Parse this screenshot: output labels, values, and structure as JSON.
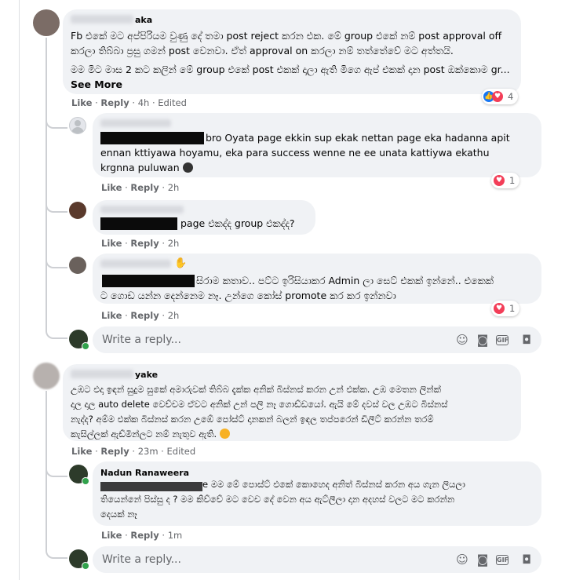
{
  "comments": [
    {
      "name_suffix": "aka",
      "para1": "Fb එකේ මට අප්පිරියම වුණු දේ තමා post reject කරන එක. මේ group එකේ නම් post approval off කරලා තිබ්බා ප්‍රසු ගමන් post වෙනවා. ඒත් approval on කරලා නම් තත්තේවේ මට අත්තයි.",
      "para2": "මම මිට මාස 2 කට කලින් මේ group එකේ post එකක් දාලා ඇති මිගෙ ඇප් එකක් දාන post ඔක්කොම gr...",
      "see_more": "See More",
      "like": "Like",
      "reply": "Reply",
      "time": "4h",
      "edited": "Edited",
      "reaction_count": "4"
    },
    {
      "text_line1": "bro Oyata page ekkin sup ekak nettan page eka hadanna apit",
      "text_line2": "ennan kttiyawa hoyamu, eka para success wenne ne ee unata kattiywa ekathu",
      "text_line3": "krgnna puluwan",
      "like": "Like",
      "reply": "Reply",
      "time": "2h",
      "reaction_count": "1"
    },
    {
      "text": "page එකද්ද group එකද්ද?",
      "like": "Like",
      "reply": "Reply",
      "time": "2h"
    },
    {
      "text_line1": "සිරාම කතාව.. පට්ට ඉරිසියාකර Admin ලා සෙට් එකක් ඉන්නේ.. එකෙක්",
      "text_line2": "ට ගොඩ යන්න දෙන්නෙම නෑ. උන්ගෙ කෝස් promote කර කර ඉන්නවා",
      "like": "Like",
      "reply": "Reply",
      "time": "2h",
      "reaction_count": "1"
    },
    {
      "name_suffix": "yake",
      "text_line1": "උඹට එදා ඉඳන් සුදුම සුකේ අමාරුවක් තිබ්බ දැක්ක අනික් බිස්නස් කරන උන් එක්ක. උඹ මෙතන ලින්ක්",
      "text_line2": "දාල දාල auto delete වෙච්චම ඒවට අනික් උන් පලි නෑ ගොඩ්ඩයෝ. ඇයි මේ දවස් වල උඹට බිස්නස්",
      "text_line3": "නැද්ද? අම්ම එක්ක බිස්නස් කරන උඹේ පෝස්ට් දානකන් බලන් ඉඳල තප්පරෙන් ඩිලීට් කරන්න තරම්",
      "text_line4": "කැසිල්ලක් ඇඩ්මින්ලට නම් නැතුව ඇති.",
      "like": "Like",
      "reply": "Reply",
      "time": "23m",
      "edited": "Edited"
    },
    {
      "name": "Nadun Ranaweera",
      "text_line1": "e මම මේ පොස්ට් එකේ කොහෙද අනිත් බිස්නස් කරන අය ගැන ලියලා",
      "text_line2": "තියෙන්නේ පිස්සු ද ? මම කිව්වේ මට වෙච දේ වෙන අය ඇට්ලීලා දාන අදහස් වලට මට කරන්න",
      "text_line3": "දෙයක් නෑ",
      "like": "Like",
      "reply": "Reply",
      "time": "1m"
    }
  ],
  "reply_box": {
    "placeholder": "Write a reply...",
    "icons": [
      "emoji-icon",
      "camera-icon",
      "gif-icon",
      "sticker-icon"
    ]
  },
  "colors": {
    "bubble": "#f0f2f5",
    "meta": "#65676b",
    "heart": "#f33e58",
    "like": "#1877f2",
    "online": "#31a24c"
  }
}
